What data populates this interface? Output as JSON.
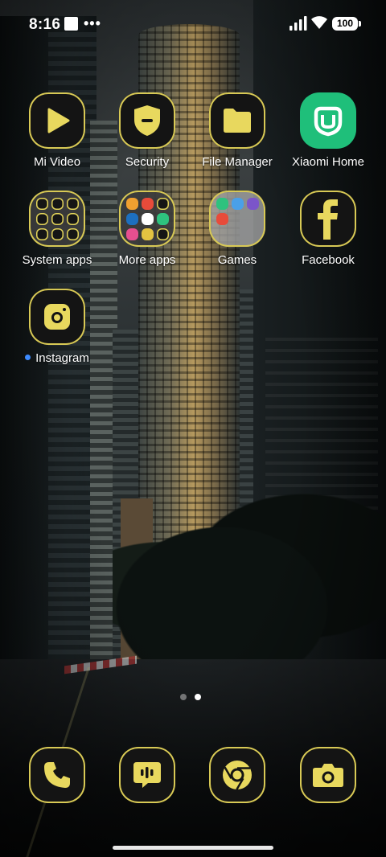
{
  "status_bar": {
    "time": "8:16",
    "more_indicator": "•••",
    "battery": "100"
  },
  "apps": [
    {
      "label": "Mi Video",
      "icon": "play-icon"
    },
    {
      "label": "Security",
      "icon": "shield-icon"
    },
    {
      "label": "File Manager",
      "icon": "folder-icon"
    },
    {
      "label": "Xiaomi Home",
      "icon": "xiaomi-home-icon"
    },
    {
      "label": "System apps",
      "icon": "folder-grid-icon"
    },
    {
      "label": "More apps",
      "icon": "folder-grid-icon"
    },
    {
      "label": "Games",
      "icon": "folder-grid-icon"
    },
    {
      "label": "Facebook",
      "icon": "facebook-icon"
    },
    {
      "label": "Instagram",
      "icon": "instagram-icon"
    }
  ],
  "dock": [
    {
      "name": "Phone",
      "icon": "phone-icon"
    },
    {
      "name": "Messaging",
      "icon": "message-icon"
    },
    {
      "name": "Chrome",
      "icon": "chrome-icon"
    },
    {
      "name": "Camera",
      "icon": "camera-icon"
    }
  ],
  "page_indicator": {
    "pages": 2,
    "current": 2
  },
  "colors": {
    "icon_accent": "#e8d85e",
    "icon_bg": "#141414",
    "xiaomi_green": "#1fbf7a",
    "notification_dot": "#3d8bff"
  }
}
